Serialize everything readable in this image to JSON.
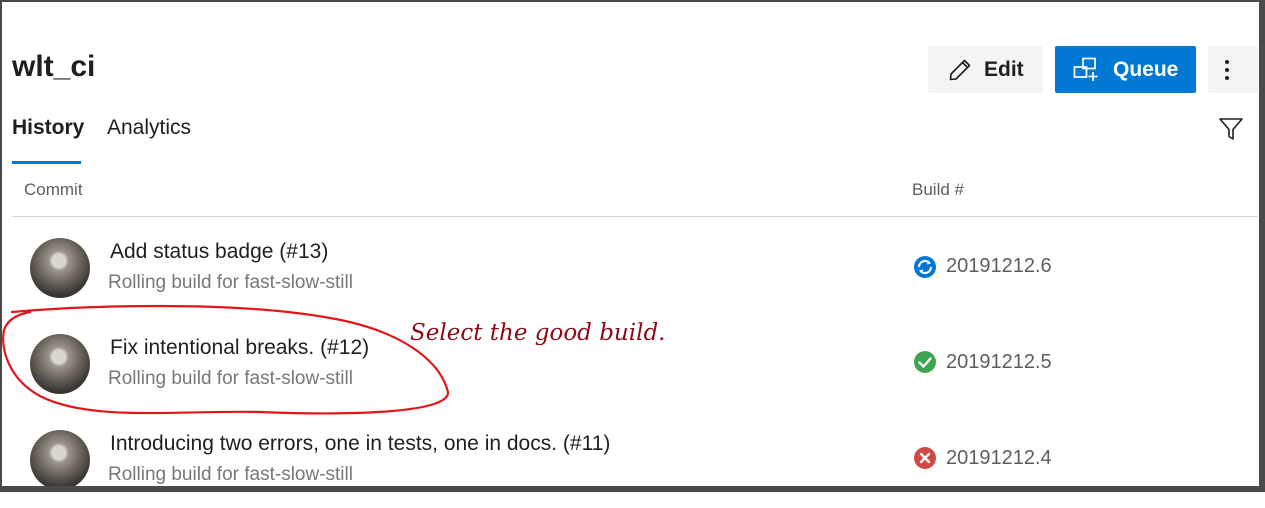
{
  "header": {
    "title": "wlt_ci",
    "edit_label": "Edit",
    "queue_label": "Queue",
    "more_icon": "more-vertical-icon"
  },
  "tabs": [
    {
      "label": "History",
      "selected": true
    },
    {
      "label": "Analytics",
      "selected": false
    }
  ],
  "filter_icon": "filter-icon",
  "columns": {
    "commit": "Commit",
    "build": "Build #"
  },
  "rows": [
    {
      "title": "Add status badge (#13)",
      "subtitle": "Rolling build for fast-slow-still",
      "build": "20191212.6",
      "status": "in-progress"
    },
    {
      "title": "Fix intentional breaks. (#12)",
      "subtitle": "Rolling build for fast-slow-still",
      "build": "20191212.5",
      "status": "succeeded"
    },
    {
      "title": "Introducing two errors, one in tests, one in docs. (#11)",
      "subtitle": "Rolling build for fast-slow-still",
      "build": "20191212.4",
      "status": "failed"
    }
  ],
  "annotation": "Select the good build.",
  "colors": {
    "accent": "#0078d4",
    "success": "#3fa451",
    "failure": "#cd4a45",
    "annotation": "#8b0a14"
  }
}
